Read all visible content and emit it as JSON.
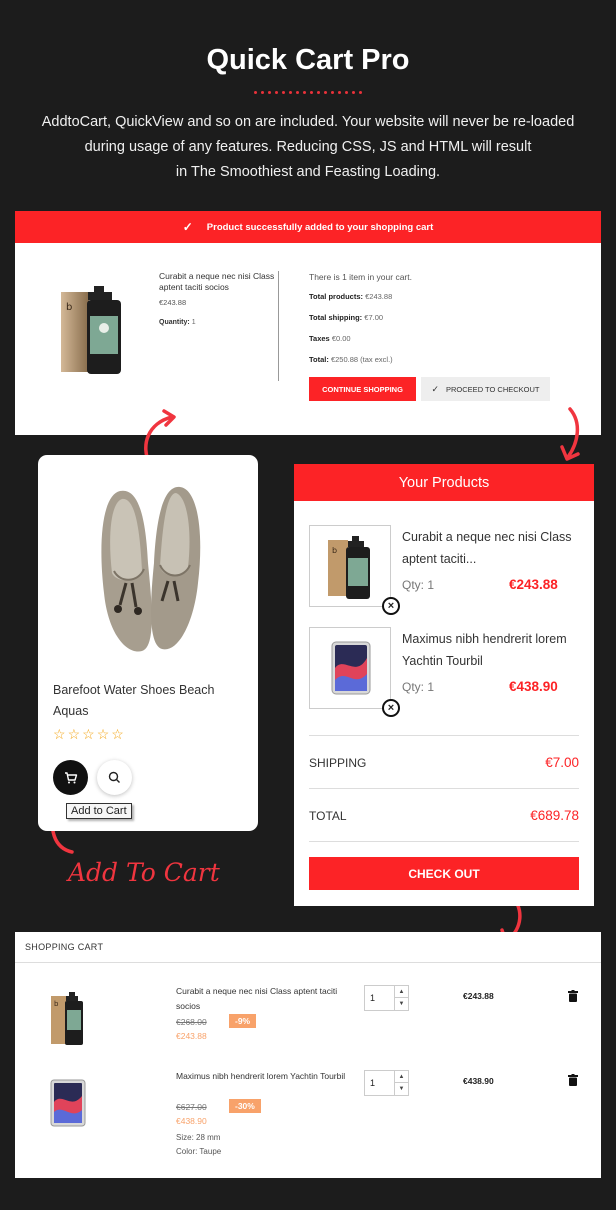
{
  "hero": {
    "title": "Quick Cart Pro",
    "desc_line1": "AddtoCart, QuickView and so on are included. Your website will never be re-loaded",
    "desc_line2": "during usage of any features. Reducing CSS, JS and HTML will result",
    "desc_line3": "in The Smoothiest and Feasting Loading."
  },
  "popup": {
    "banner": "Product successfully added to your shopping cart",
    "product_name": "Curabit a neque nec nisi Class aptent taciti socios",
    "product_price": "€243.88",
    "quantity_label": "Quantity:",
    "quantity_value": "1",
    "summary_intro": "There is 1 item in your cart.",
    "total_products_label": "Total products:",
    "total_products_value": "€243.88",
    "total_shipping_label": "Total shipping:",
    "total_shipping_value": "€7.00",
    "taxes_label": "Taxes",
    "taxes_value": "€0.00",
    "total_label": "Total:",
    "total_value": "€250.88 (tax excl.)",
    "continue_label": "CONTINUE SHOPPING",
    "checkout_label": "PROCEED TO CHECKOUT"
  },
  "card": {
    "title": "Barefoot Water Shoes Beach Aquas",
    "rating": 0,
    "tooltip": "Add to Cart"
  },
  "your_products": {
    "header": "Your Products",
    "items": [
      {
        "name": "Curabit a neque nec nisi Class aptent taciti...",
        "qty": "Qty: 1",
        "price": "€243.88"
      },
      {
        "name": "Maximus nibh hendrerit lorem Yachtin Tourbil",
        "qty": "Qty: 1",
        "price": "€438.90"
      }
    ],
    "shipping_label": "SHIPPING",
    "shipping_value": "€7.00",
    "total_label": "TOTAL",
    "total_value": "€689.78",
    "checkout_label": "CHECK OUT"
  },
  "hand_label": "Add To Cart",
  "shopping_cart": {
    "header": "SHOPPING CART",
    "rows": [
      {
        "name": "Curabit a neque nec nisi Class aptent taciti socios",
        "old_price": "€268.00",
        "discount": "-9%",
        "new_price": "€243.88",
        "qty": "1",
        "total": "€243.88"
      },
      {
        "name": "Maximus nibh hendrerit lorem Yachtin Tourbil",
        "old_price": "€627.00",
        "discount": "-30%",
        "new_price": "€438.90",
        "size": "Size: 28 mm",
        "color": "Color: Taupe",
        "qty": "1",
        "total": "€438.90"
      }
    ]
  },
  "colors": {
    "accent": "#fc2326",
    "background": "#1c1c1c",
    "discount": "#f8a26a",
    "star": "#f3a515"
  },
  "icons": [
    "check-icon",
    "cart-icon",
    "search-icon",
    "close-icon",
    "trash-icon",
    "curved-arrow-icon",
    "star-icon"
  ]
}
